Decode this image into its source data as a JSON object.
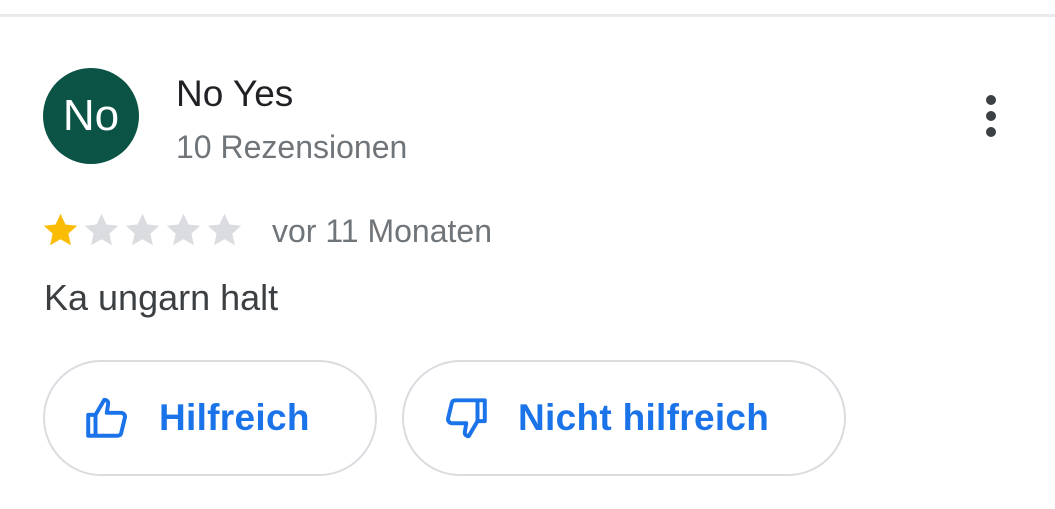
{
  "review": {
    "avatar_initials": "No",
    "avatar_color": "#0b5345",
    "reviewer_name": "No Yes",
    "review_count": "10 Rezensionen",
    "rating": 1,
    "rating_max": 5,
    "date": "vor 11 Monaten",
    "text": "Ka ungarn halt",
    "more_icon": "more-vert-icon"
  },
  "actions": {
    "helpful_label": "Hilfreich",
    "helpful_icon": "thumbs-up-icon",
    "not_helpful_label": "Nicht hilfreich",
    "not_helpful_icon": "thumbs-down-icon"
  },
  "colors": {
    "star_filled": "#fbbc04",
    "star_empty": "#dadce0",
    "accent": "#1a73e8"
  }
}
